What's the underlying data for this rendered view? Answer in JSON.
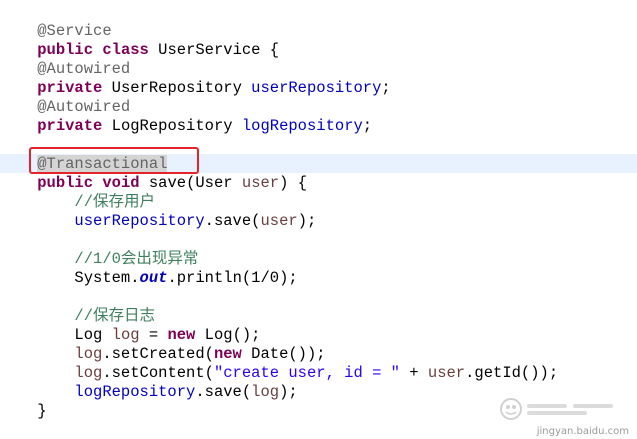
{
  "code": {
    "l01_ann": "@Service",
    "l02_kw1": "public",
    "l02_kw2": "class",
    "l02_rest": " UserService {",
    "l04_ann": "@Autowired",
    "l05_kw": "private",
    "l05_type": " UserRepository ",
    "l05_field": "userRepository",
    "l05_end": ";",
    "l06_ann": "@Autowired",
    "l07_kw": "private",
    "l07_type": " LogRepository ",
    "l07_field": "logRepository",
    "l07_end": ";",
    "l09_ann": "@Transactional",
    "l10_kw1": "public",
    "l10_kw2": "void",
    "l10_mid": " save(User ",
    "l10_param": "user",
    "l10_end": ") {",
    "l11_cmt": "//保存用户",
    "l12_field": "userRepository",
    "l12_mid": ".save(",
    "l12_var": "user",
    "l12_end": ");",
    "l14_cmt": "//1/0会出现异常",
    "l15_pre": "System.",
    "l15_sfield": "out",
    "l15_post": ".println(1/0);",
    "l17_cmt": "//保存日志",
    "l18_pre": "Log ",
    "l18_var": "log",
    "l18_mid": " = ",
    "l18_kw": "new",
    "l18_post": " Log();",
    "l19_var": "log",
    "l19_mid": ".setCreated(",
    "l19_kw": "new",
    "l19_post": " Date());",
    "l20_var": "log",
    "l20_mid": ".setContent(",
    "l20_str1": "\"create user, id = \"",
    "l20_plus": " + ",
    "l20_var2": "user",
    "l20_post": ".getId());",
    "l21_field": "logRepository",
    "l21_mid": ".save(",
    "l21_var": "log",
    "l21_end": ");",
    "l22_brace": "}"
  },
  "watermark": {
    "url": "jingyan.baidu.com"
  },
  "colors": {
    "keyword": "#7f0055",
    "annotation": "#646464",
    "field": "#0000c0",
    "local_var": "#6a3e3e",
    "comment": "#3f7f5f",
    "string": "#2a00ff",
    "current_line": "#e8f2fe",
    "highlight_box": "#e3242b"
  }
}
